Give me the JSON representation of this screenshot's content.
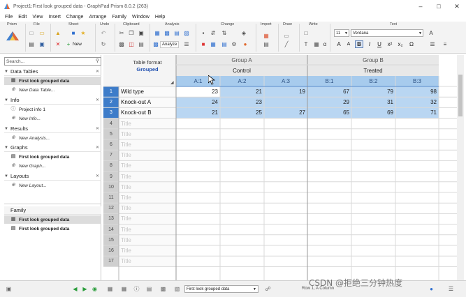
{
  "window": {
    "title": "Project1:First look grouped data - GraphPad Prism 8.0.2 (263)"
  },
  "menu": [
    "File",
    "Edit",
    "View",
    "Insert",
    "Change",
    "Arrange",
    "Family",
    "Window",
    "Help"
  ],
  "ribbon": {
    "groups": [
      "Prism",
      "File",
      "Sheet",
      "Undo",
      "Clipboard",
      "Analysis",
      "Change",
      "Import",
      "Draw",
      "Write",
      "Text"
    ],
    "analyze_label": "Analyze",
    "new_label": "New",
    "font_size": "11",
    "font_name": "Verdana",
    "write_symbols": [
      "T",
      "α"
    ],
    "text_buttons": [
      "A",
      "A",
      "B",
      "I",
      "U",
      "x²",
      "x₂",
      "Ω"
    ]
  },
  "navigator": {
    "search_placeholder": "Search...",
    "sections": [
      {
        "label": "Data Tables",
        "items": [
          {
            "label": "First look grouped data",
            "selected": true
          },
          {
            "label": "New Data Table...",
            "new": true
          }
        ]
      },
      {
        "label": "Info",
        "items": [
          {
            "label": "Project info 1"
          },
          {
            "label": "New Info...",
            "new": true
          }
        ]
      },
      {
        "label": "Results",
        "items": [
          {
            "label": "New Analysis...",
            "new": true
          }
        ]
      },
      {
        "label": "Graphs",
        "items": [
          {
            "label": "First look grouped data"
          },
          {
            "label": "New Graph...",
            "new": true
          }
        ]
      },
      {
        "label": "Layouts",
        "items": [
          {
            "label": "New Layout...",
            "new": true
          }
        ]
      }
    ],
    "family": {
      "label": "Family",
      "items": [
        {
          "label": "First look grouped data",
          "selected": true
        },
        {
          "label": "First look grouped data"
        }
      ]
    }
  },
  "table": {
    "format_label": "Table format",
    "format_value": "Grouped",
    "groups": [
      {
        "label": "Group A",
        "title": "Control",
        "columns": [
          "A:1",
          "A:2",
          "A:3"
        ]
      },
      {
        "label": "Group B",
        "title": "Treated",
        "columns": [
          "B:1",
          "B:2",
          "B:3"
        ]
      }
    ],
    "rows": [
      {
        "num": "1",
        "title": "Wild type",
        "values": [
          "23",
          "21",
          "19",
          "67",
          "79",
          "98"
        ]
      },
      {
        "num": "2",
        "title": "Knock-out A",
        "values": [
          "24",
          "23",
          "",
          "29",
          "31",
          "32"
        ]
      },
      {
        "num": "3",
        "title": "Knock-out B",
        "values": [
          "21",
          "25",
          "27",
          "65",
          "69",
          "71"
        ]
      },
      {
        "num": "4",
        "title": "Title",
        "values": []
      },
      {
        "num": "5",
        "title": "Title",
        "values": []
      },
      {
        "num": "6",
        "title": "Title",
        "values": []
      },
      {
        "num": "7",
        "title": "Title",
        "values": []
      },
      {
        "num": "8",
        "title": "Title",
        "values": []
      },
      {
        "num": "9",
        "title": "Title",
        "values": []
      },
      {
        "num": "10",
        "title": "Title",
        "values": []
      },
      {
        "num": "11",
        "title": "Title",
        "values": []
      },
      {
        "num": "12",
        "title": "Title",
        "values": []
      },
      {
        "num": "13",
        "title": "Title",
        "values": []
      },
      {
        "num": "14",
        "title": "Title",
        "values": []
      },
      {
        "num": "15",
        "title": "Title",
        "values": []
      },
      {
        "num": "16",
        "title": "Title",
        "values": []
      },
      {
        "num": "17",
        "title": "Title",
        "values": []
      }
    ]
  },
  "status": {
    "sheet_selector": "First look grouped data",
    "rowcol": "Row 1, A Column"
  },
  "watermark": "CSDN @拒绝三分钟热度",
  "colors": {
    "selection": "#b9d6f2",
    "column_header": "#a7cbed",
    "row_header": "#cfcfcf",
    "row_selected_num": "#3d7cc9",
    "group_header": "#e8e8e8",
    "grid": "#d9d9d9"
  }
}
